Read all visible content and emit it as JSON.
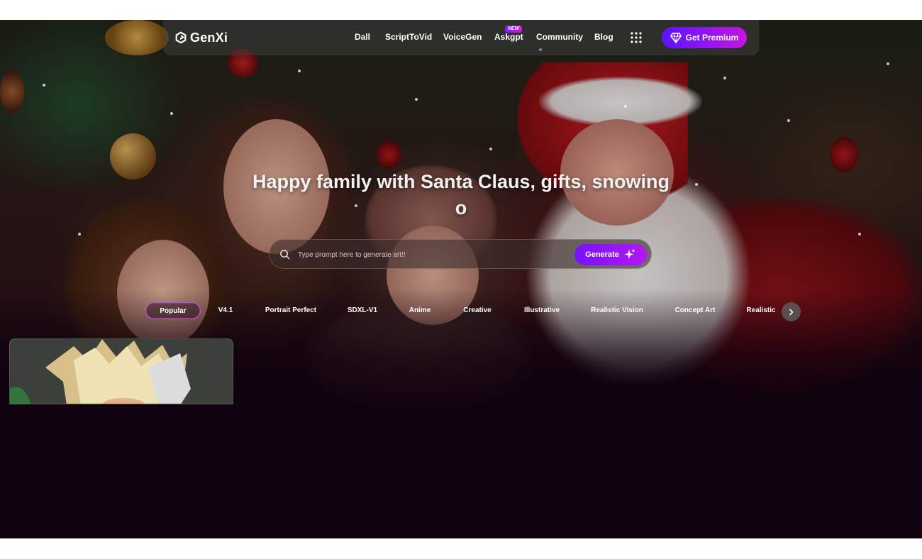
{
  "brand": {
    "name": "GenXi"
  },
  "nav": {
    "links": [
      "Dall",
      "ScriptToVid",
      "VoiceGen",
      "Askgpt",
      "Community",
      "Blog"
    ],
    "new_badge": "NEW",
    "premium_label": "Get Premium"
  },
  "hero": {
    "title": "Happy family with Santa Claus, gifts, snowing o"
  },
  "search": {
    "placeholder": "Type prompt here to generate art!!",
    "value": "",
    "generate_label": "Generate"
  },
  "tabs": {
    "items": [
      "Popular",
      "V4.1",
      "Portrait Perfect",
      "SDXL-V1",
      "Anime",
      "Creative",
      "Illustrative",
      "Realistic Vision",
      "Concept Art",
      "Realistic"
    ],
    "active": "Popular"
  },
  "colors": {
    "background": "#10020f",
    "accent_start": "#5a14ff",
    "accent_end": "#c814e0",
    "active_tab_border": "#c24bd8"
  },
  "icons": {
    "logo": "genxi-logo-icon",
    "apps": "grid-dots-icon",
    "premium": "diamond-icon",
    "search": "search-icon",
    "generate": "sparkle-icon",
    "next": "chevron-right-icon"
  }
}
